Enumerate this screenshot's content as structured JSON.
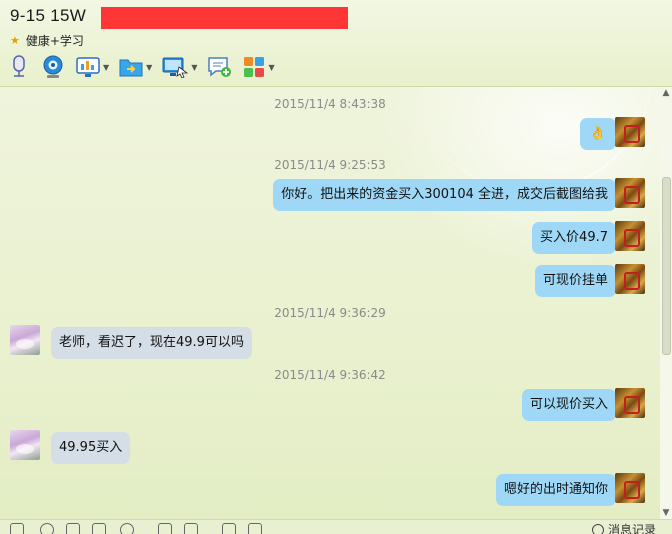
{
  "header": {
    "title": "9-15  15W",
    "subtitle": "健康+学习"
  },
  "toolbar": {
    "icons": [
      "microphone-icon",
      "webcam-icon",
      "screen-share-icon",
      "file-transfer-icon",
      "remote-desktop-icon",
      "add-chat-icon",
      "apps-grid-icon"
    ]
  },
  "messages": [
    {
      "type": "time",
      "text": "2015/11/4 8:43:38"
    },
    {
      "type": "msg",
      "side": "right",
      "text": "👌"
    },
    {
      "type": "time",
      "text": "2015/11/4 9:25:53"
    },
    {
      "type": "msg",
      "side": "right",
      "text": "你好。把出来的资金买入300104  全进，成交后截图给我"
    },
    {
      "type": "msg",
      "side": "right",
      "text": "买入价49.7"
    },
    {
      "type": "msg",
      "side": "right",
      "text": "可现价挂单"
    },
    {
      "type": "time",
      "text": "2015/11/4 9:36:29"
    },
    {
      "type": "msg",
      "side": "left",
      "text": "老师，看迟了，现在49.9可以吗"
    },
    {
      "type": "time",
      "text": "2015/11/4 9:36:42"
    },
    {
      "type": "msg",
      "side": "right",
      "text": "可以现价买入"
    },
    {
      "type": "msg",
      "side": "left",
      "text": "49.95买入"
    },
    {
      "type": "msg",
      "side": "right",
      "text": "嗯好的出时通知你"
    }
  ],
  "bottom": {
    "message_record": "消息记录"
  },
  "colors": {
    "bubble_right": "#9fd8f6",
    "bubble_left": "#d5dde7",
    "redaction": "#ff3636"
  }
}
